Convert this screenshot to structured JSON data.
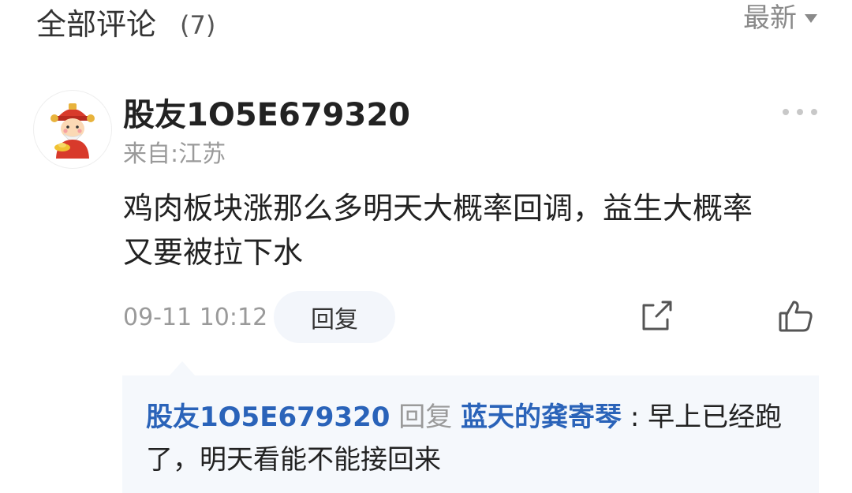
{
  "header": {
    "title": "全部评论",
    "count": "(7)",
    "sort_label": "最新"
  },
  "comment": {
    "username": "股友1O5E679320",
    "location": "来自:江苏",
    "content_lines": [
      "鸡肉板块涨那么多明天大概率回调，益生大概率",
      "又要被拉下水"
    ],
    "timestamp": "09-11 10:12",
    "reply_label": "回复"
  },
  "reply_thread": {
    "from_user": "股友1O5E679320",
    "verb": "回复",
    "to_user": "蓝天的龚寄琴",
    "separator": " : ",
    "text_first": "早上已经跑",
    "text_second": "了，明天看能不能接回来"
  },
  "icons": {
    "sort": "chevron-down-icon",
    "more": "more-dots-icon",
    "share": "share-icon",
    "like": "thumbs-up-icon",
    "avatar": "avatar-icon"
  },
  "colors": {
    "accent_blue": "#2a63b9",
    "muted": "#9a9a9a",
    "thread_bg": "#f5f8fc",
    "button_bg": "#f3f6fb"
  }
}
